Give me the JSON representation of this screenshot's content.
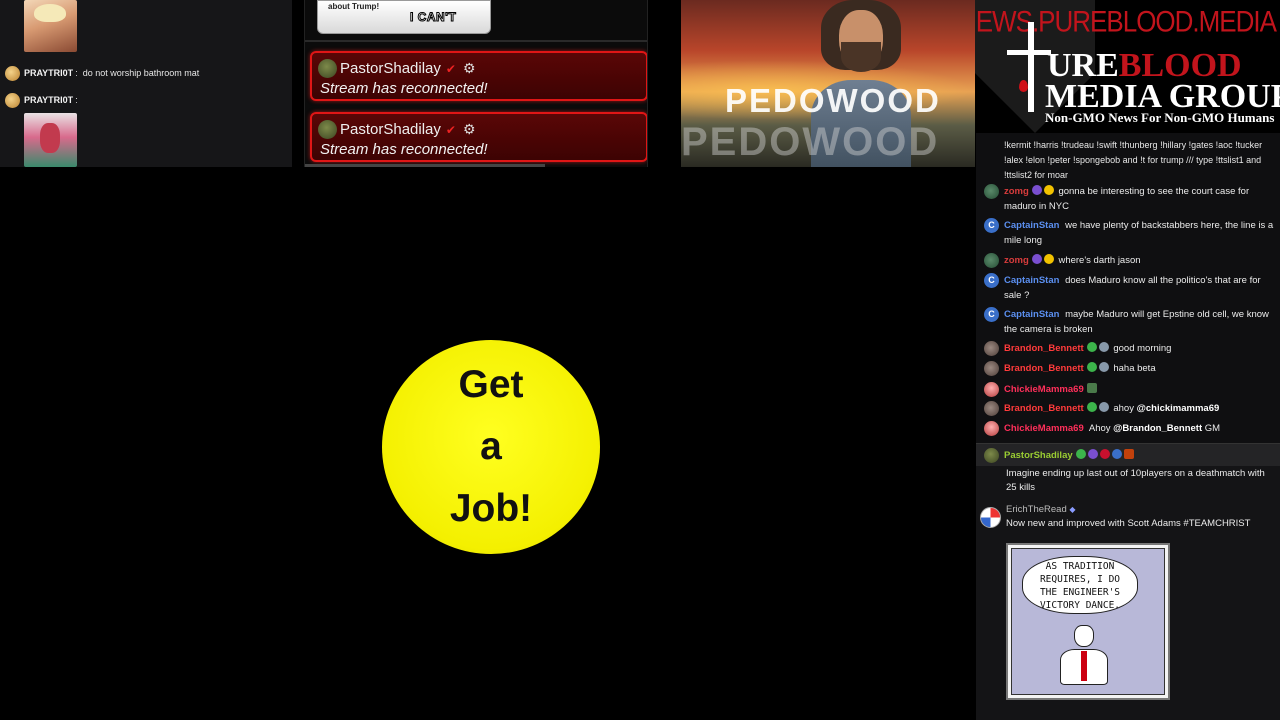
{
  "left_chat": {
    "messages": [
      {
        "user": "PRAYTRI0T",
        "separator": ":",
        "text": "do not worship bathroom mat"
      },
      {
        "user": "PRAYTRI0T",
        "separator": ":",
        "text": ""
      }
    ]
  },
  "alerts": {
    "meme_top_text": "about Trump!",
    "meme_caption": "I CAN'T",
    "items": [
      {
        "user": "PastorShadilay",
        "message": "Stream has reconnected!"
      },
      {
        "user": "PastorShadilay",
        "message": "Stream has reconnected!"
      }
    ]
  },
  "video": {
    "sign_front": "PEDOWOOD",
    "sign_back": "PEDOWOOD"
  },
  "logo": {
    "url": "NEWS.PUREBLOOD.MEDIA",
    "pure": "URE",
    "blood": "BLOOD",
    "media_group": "MEDIA GROUP",
    "tagline": "Non-GMO News For Non-GMO Humans"
  },
  "right_chat": {
    "commands_text": "!kermit !harris !trudeau !swift !thunberg !hillary !gates !aoc !tucker !alex !elon !peter !spongebob and !t for trump /// type !ttslist1 and !ttslist2 for moar",
    "messages": [
      {
        "user": "zomg",
        "text": "gonna be interesting to see the court case for maduro in NYC"
      },
      {
        "user": "CaptainStan",
        "text": "we have plenty of backstabbers here, the line is a mile long"
      },
      {
        "user": "zomg",
        "text": "where's darth jason"
      },
      {
        "user": "CaptainStan",
        "text": "does Maduro know all the politico's that are for sale ?"
      },
      {
        "user": "CaptainStan",
        "text": "maybe Maduro will get Epstine old cell, we know the camera is broken"
      },
      {
        "user": "Brandon_Bennett",
        "text": "good morning"
      },
      {
        "user": "Brandon_Bennett",
        "text": "haha beta"
      },
      {
        "user": "ChickieMamma69",
        "text": ""
      },
      {
        "user": "Brandon_Bennett",
        "text": "ahoy",
        "mention": "@chickimamma69"
      },
      {
        "user": "ChickieMamma69",
        "text": "Ahoy",
        "mention": "@Brandon_Bennett",
        "after": "GM"
      }
    ],
    "pastor_row_user": "PastorShadilay",
    "lower_messages": [
      {
        "text": "Imagine ending up last out of 10players on a deathmatch with 25 kills"
      },
      {
        "user": "ErichTheRead",
        "text": "Now new and improved with Scott Adams #TEAMCHRIST"
      }
    ],
    "comic_text_lines": [
      "AS TRADITION",
      "REQUIRES, I DO",
      "THE ENGINEER'S",
      "VICTORY DANCE."
    ]
  },
  "overlay": {
    "circle_lines": [
      "Get",
      "a",
      "Job!"
    ],
    "circle_color": "#f4f000"
  }
}
